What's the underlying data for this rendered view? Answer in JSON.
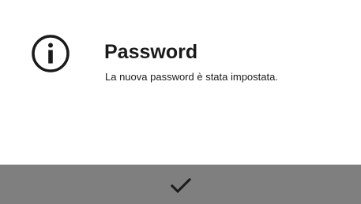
{
  "dialog": {
    "icon": "info-icon",
    "title": "Password",
    "message": "La nuova password è stata impostata."
  },
  "footer": {
    "confirm_icon": "checkmark-icon",
    "background_color": "#7f7f80"
  }
}
